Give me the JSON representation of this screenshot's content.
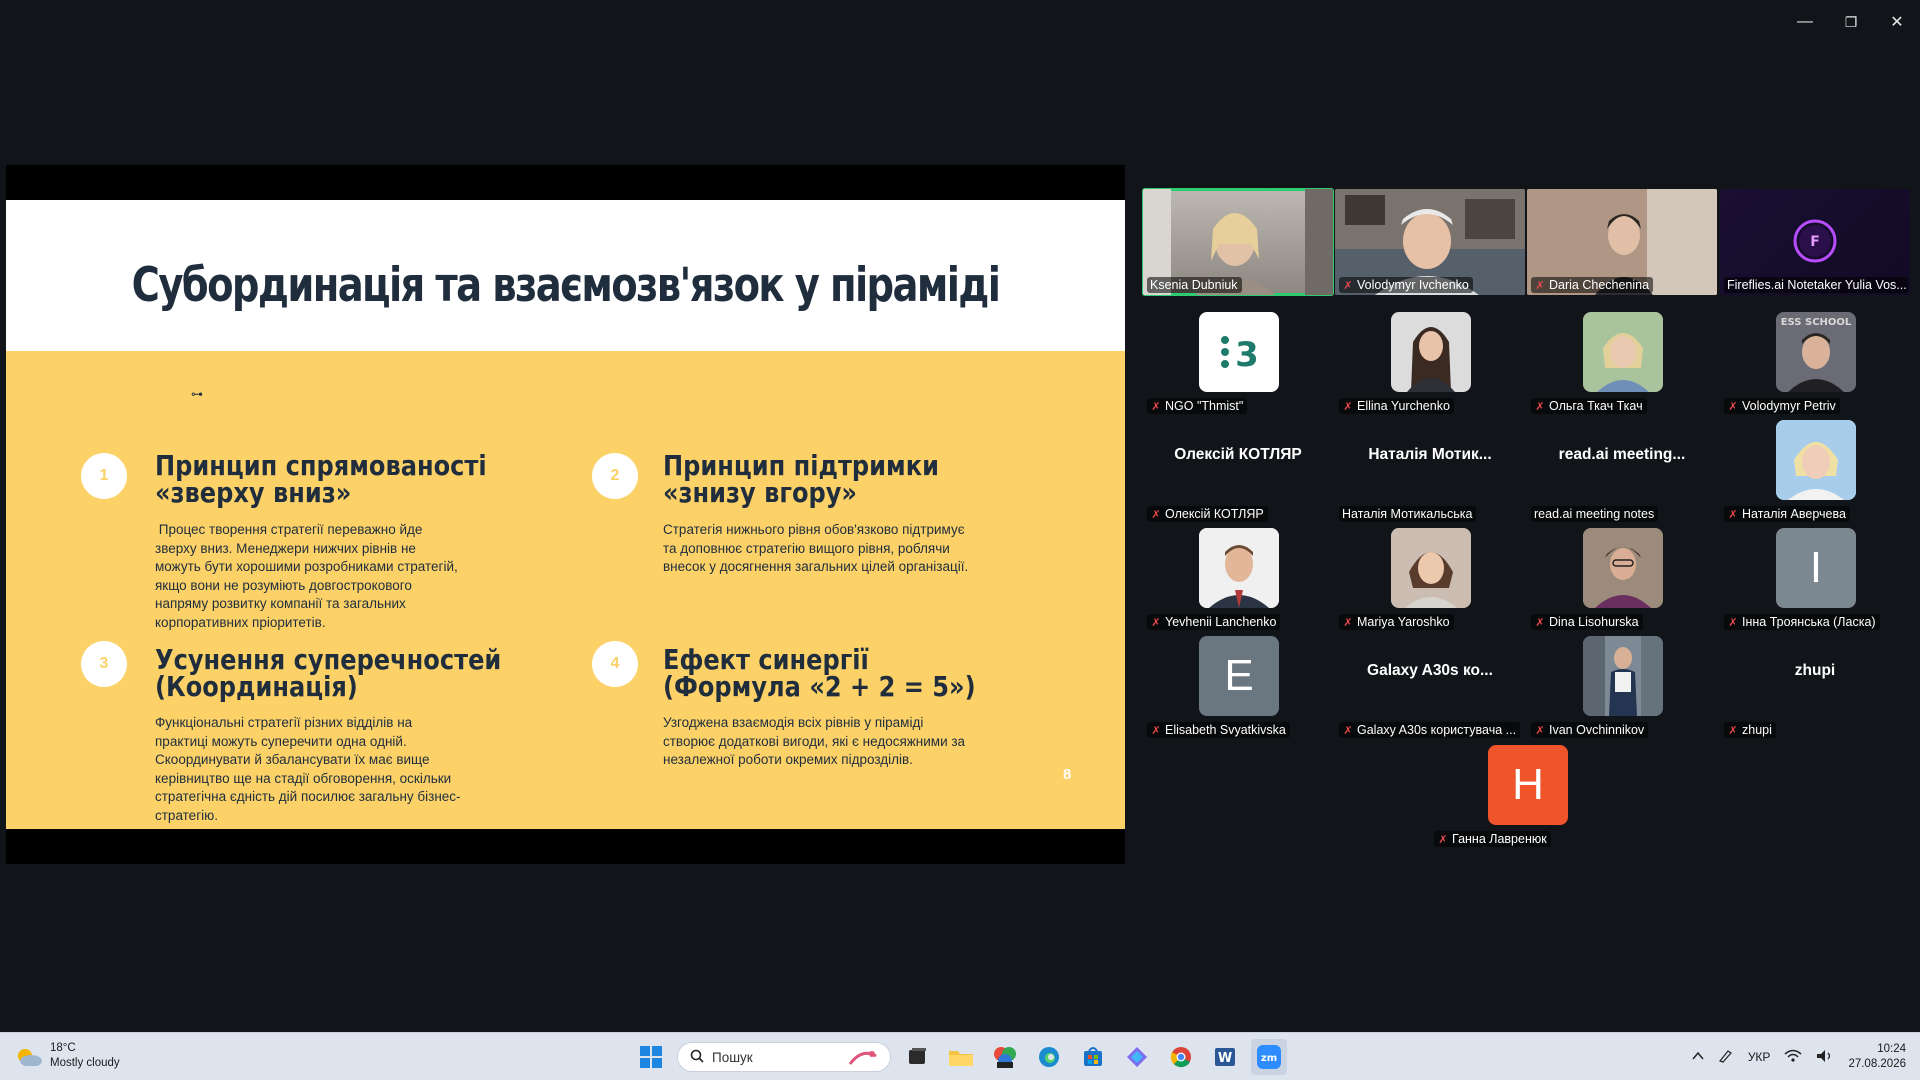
{
  "window_controls": {
    "minimize": "—",
    "restore": "❐",
    "close": "✕"
  },
  "slide": {
    "title": "Субординація та взаємозв'язок у піраміді",
    "decoration": "⊶",
    "page_number": "8",
    "principles": [
      {
        "number": "1",
        "title_line1": "Принцип спрямованості",
        "title_line2": "«зверху вниз»",
        "text_lines": [
          " Процес творення стратегії переважно йде",
          "зверху вниз. Менеджери нижчих рівнів не",
          "можуть бути хорошими розробниками стратегій,",
          "якщо вони не розуміють довгострокового",
          "напряму розвитку компанії та загальних",
          "корпоративних пріоритетів."
        ]
      },
      {
        "number": "2",
        "title_line1": "Принцип підтримки",
        "title_line2": "«знизу вгору»",
        "text_lines": [
          "Стратегія нижнього рівня обов'язково підтримує",
          "та доповнює стратегію вищого рівня, роблячи",
          "внесок у досягнення загальних цілей організації."
        ]
      },
      {
        "number": "3",
        "title_line1": "Усунення суперечностей",
        "title_line2": "(Координація)",
        "text_lines": [
          "Функціональні стратегії різних відділів на",
          "практиці можуть суперечити одна одній.",
          "Скоординувати й збалансувати їх має вище",
          "керівництво ще на стадії обговорення, оскільки",
          "стратегічна єдність дій посилює загальну бізнес-",
          "стратегію."
        ]
      },
      {
        "number": "4",
        "title_line1": "Ефект синергії",
        "title_line2": "(Формула «2 + 2 = 5»)",
        "text_lines": [
          "Узгоджена взаємодія всіх рівнів у піраміді",
          "створює додаткові вигоди, які є недосяжними за",
          "незалежної роботи окремих підрозділів."
        ]
      }
    ]
  },
  "gallery": {
    "participants": [
      {
        "name": "Ksenia Dubniuk",
        "kind": "video",
        "muted": false,
        "active": true
      },
      {
        "name": "Volodymyr Ivchenko",
        "kind": "video",
        "muted": true
      },
      {
        "name": "Daria Chechenina",
        "kind": "video",
        "muted": true
      },
      {
        "name": "Fireflies.ai Notetaker Yulia Vos...",
        "kind": "video",
        "muted": false
      },
      {
        "name": "NGO \"Thmist\"",
        "kind": "avatar",
        "muted": true
      },
      {
        "name": "Ellina Yurchenko",
        "kind": "avatar",
        "muted": true
      },
      {
        "name": "Ольга Ткач Ткач",
        "kind": "avatar",
        "muted": true
      },
      {
        "name": "Volodymyr Petriv",
        "kind": "avatar",
        "muted": true,
        "avatar_text": "ESS SCHOOL"
      },
      {
        "name": "Олексій КОТЛЯР",
        "kind": "nameonly",
        "display": "Олексій КОТЛЯР",
        "muted": true
      },
      {
        "name": "Наталія Мотикальська",
        "kind": "nameonly",
        "display": "Наталія  Мотик...",
        "muted": false
      },
      {
        "name": "read.ai meeting notes",
        "kind": "nameonly",
        "display": "read.ai  meeting...",
        "muted": false
      },
      {
        "name": "Наталія Аверчева",
        "kind": "avatar",
        "muted": true
      },
      {
        "name": "Yevhenii Lanchenko",
        "kind": "avatar",
        "muted": true
      },
      {
        "name": "Mariya Yaroshko",
        "kind": "avatar",
        "muted": true
      },
      {
        "name": "Dina Lisohurska",
        "kind": "avatar",
        "muted": true
      },
      {
        "name": "Інна Троянська (Ласка)",
        "kind": "letter",
        "letter": "І",
        "muted": true
      },
      {
        "name": "Elisabeth Svyatkivska",
        "kind": "letter",
        "letter": "E",
        "muted": true
      },
      {
        "name": "Galaxy A30s користувача ...",
        "kind": "nameonly",
        "display": "Galaxy A30s ко...",
        "muted": true
      },
      {
        "name": "Ivan Ovchinnikov",
        "kind": "avatar",
        "muted": true
      },
      {
        "name": "zhupi",
        "kind": "nameonly",
        "display": "zhupi",
        "muted": true
      },
      {
        "name": "Ганна Лавренюк",
        "kind": "letter",
        "letter": "Н",
        "muted": true
      }
    ]
  },
  "taskbar": {
    "weather": {
      "temp": "18°C",
      "condition": "Mostly cloudy"
    },
    "search_placeholder": "Пошук",
    "language": "УКР",
    "time": "10:24",
    "date": "27.08.2026"
  },
  "colors": {
    "slide_yellow": "#fbd168",
    "slide_dark": "#1f2d3d",
    "active_speaker": "#2ecc71",
    "muted_red": "#e5484d"
  }
}
